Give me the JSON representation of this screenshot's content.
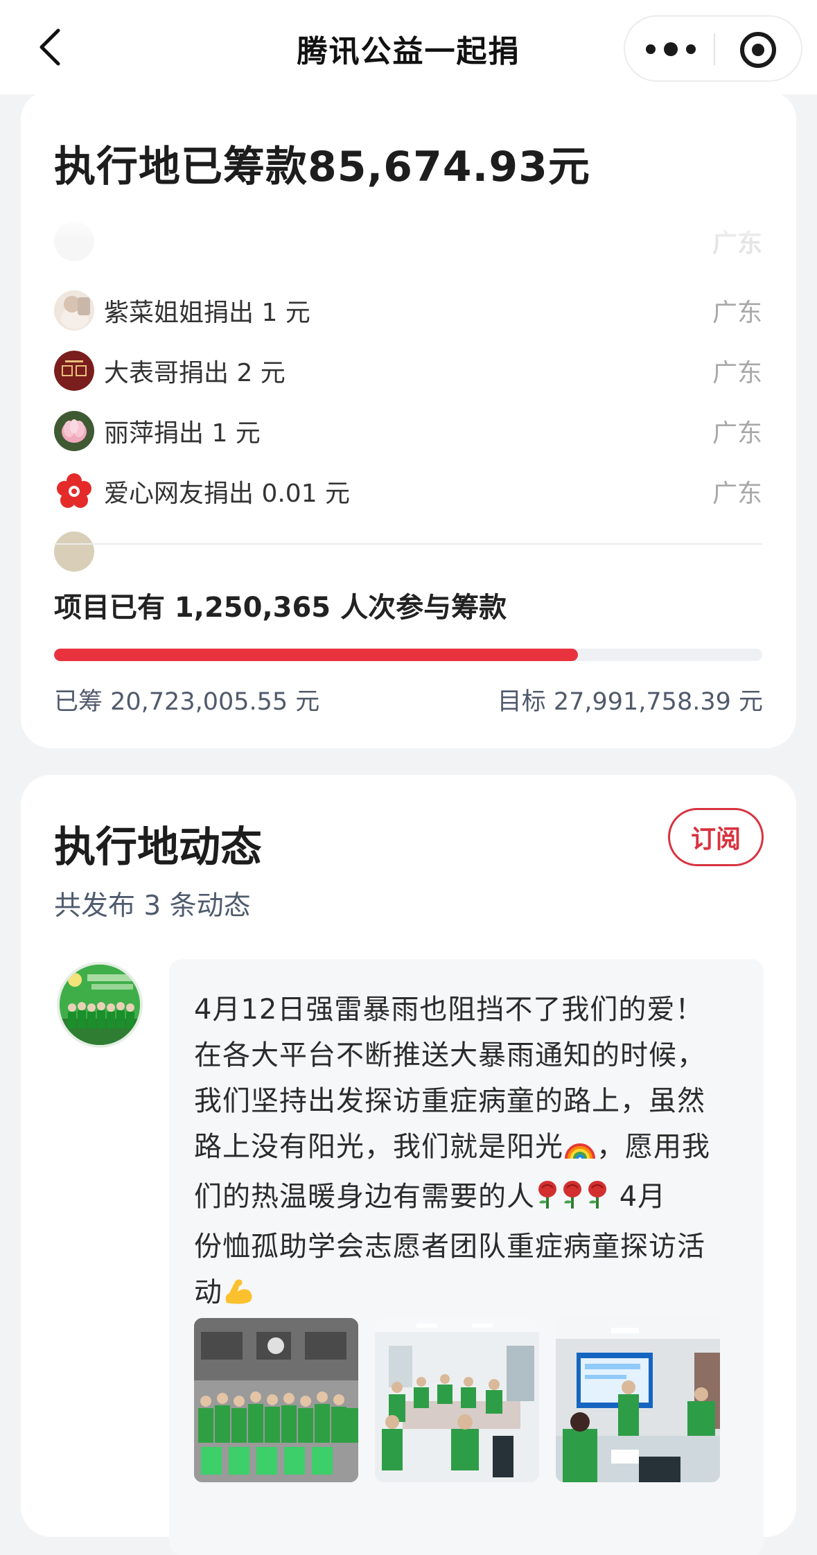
{
  "navbar": {
    "title": "腾讯公益一起捐"
  },
  "fund": {
    "heading": "执行地已筹款85,674.93元",
    "faded_region": "广东",
    "donors": [
      {
        "text": "紫菜姐姐捐出 1 元",
        "region": "广东",
        "avatar": "photo-avatar"
      },
      {
        "text": "大表哥捐出 2 元",
        "region": "广东",
        "avatar": "badge-avatar"
      },
      {
        "text": "丽萍捐出 1 元",
        "region": "广东",
        "avatar": "lotus-avatar"
      },
      {
        "text": "爱心网友捐出 0.01 元",
        "region": "广东",
        "avatar": "red-flower-avatar"
      }
    ],
    "participants": "项目已有 1,250,365 人次参与筹款",
    "progress_fraction": 0.74,
    "raised": "已筹 20,723,005.55 元",
    "goal": "目标 27,991,758.39 元"
  },
  "news": {
    "heading": "执行地动态",
    "subscribe_label": "订阅",
    "count": "共发布 3 条动态",
    "post": {
      "line1": "4月12日强雷暴雨也阻挡不了我们的爱！",
      "line2": "在各大平台不断推送大暴雨通知的时候，",
      "line3": "我们坚持出发探访重症病童的路上，虽然",
      "line4_a": "路上没有阳光，我们就是阳光",
      "line4_b": "，愿用我",
      "line5_a": "们的热温暖身边有需要的人",
      "line5_b": " 4月",
      "line6": "份恤孤助学会志愿者团队重症病童探访活",
      "line7": "动",
      "photos": [
        "group-photo",
        "meeting-photo",
        "presentation-photo"
      ]
    }
  },
  "colors": {
    "accent": "#e8333f",
    "subscribe": "#d8333f",
    "card": "#ffffff",
    "background": "#f2f3f5"
  }
}
